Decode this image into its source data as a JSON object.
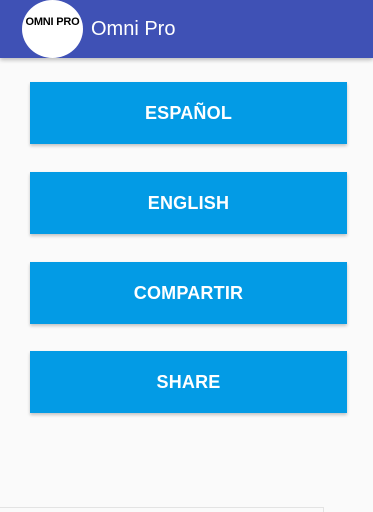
{
  "app_bar": {
    "logo_text": "OMNI PRO",
    "title": "Omni Pro",
    "color": "#3f51b5"
  },
  "menu": {
    "button_color": "#039be5",
    "buttons": [
      {
        "label": "ESPAÑOL"
      },
      {
        "label": "ENGLISH"
      },
      {
        "label": "COMPARTIR"
      },
      {
        "label": "SHARE"
      }
    ]
  }
}
